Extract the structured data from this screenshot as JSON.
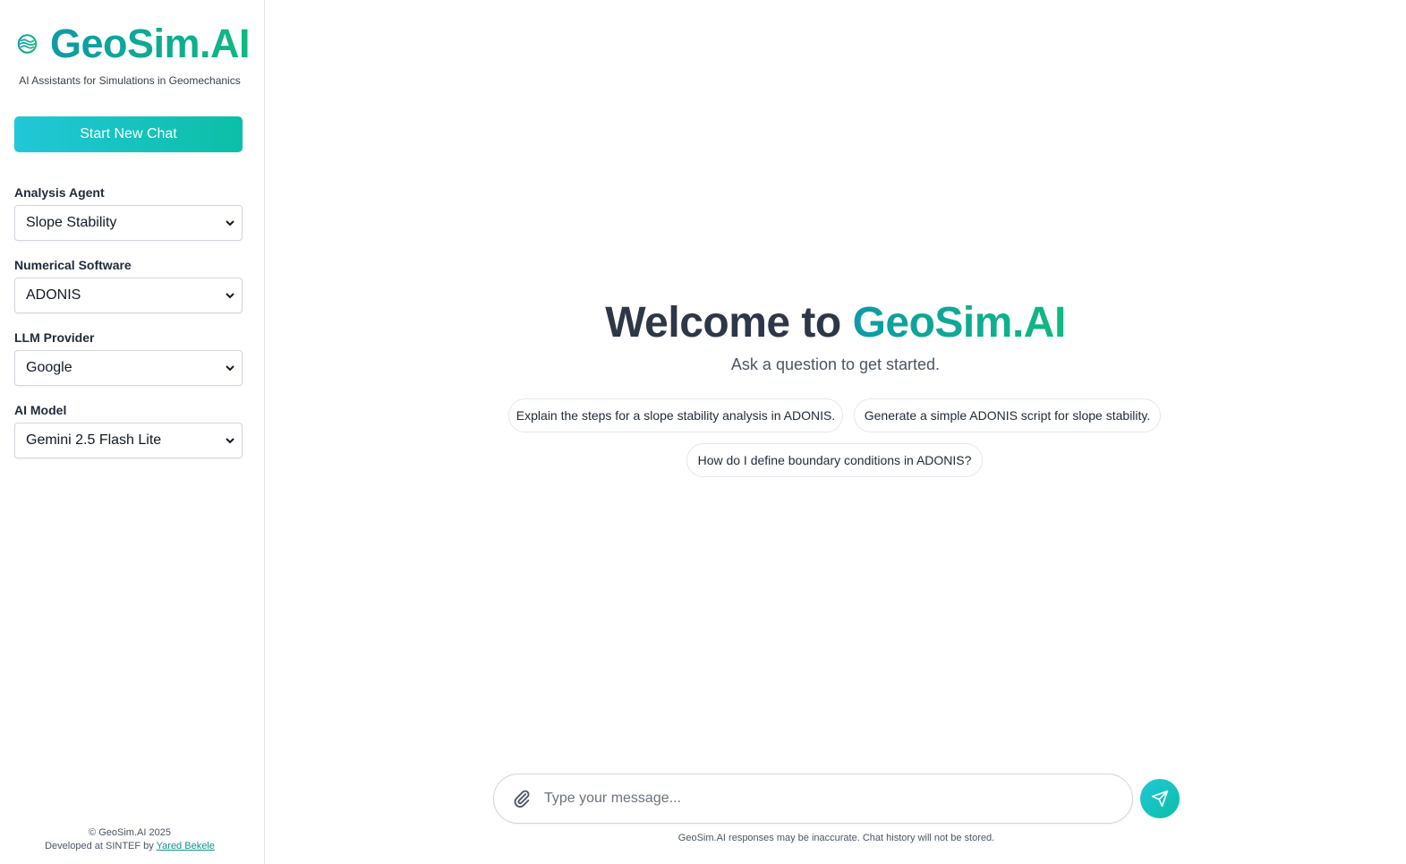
{
  "sidebar": {
    "brand_name": "GeoSim.AI",
    "brand_subtitle": "AI Assistants for Simulations in Geomechanics",
    "new_chat_label": "Start New Chat",
    "fields": [
      {
        "label": "Analysis Agent",
        "value": "Slope Stability"
      },
      {
        "label": "Numerical Software",
        "value": "ADONIS"
      },
      {
        "label": "LLM Provider",
        "value": "Google"
      },
      {
        "label": "AI Model",
        "value": "Gemini 2.5 Flash Lite"
      }
    ],
    "footer": {
      "copyright": "© GeoSim.AI 2025",
      "developed_prefix": "Developed at SINTEF by ",
      "author_link": "Yared Bekele"
    }
  },
  "main": {
    "welcome_prefix": "Welcome to ",
    "welcome_accent": "GeoSim.AI",
    "subtitle": "Ask a question to get started.",
    "suggestions": [
      "Explain the steps for a slope stability analysis in ADONIS.",
      "Generate a simple ADONIS script for slope stability.",
      "How do I define boundary conditions in ADONIS?"
    ],
    "composer": {
      "placeholder": "Type your message...",
      "value": ""
    },
    "disclaimer": "GeoSim.AI responses may be inaccurate. Chat history will not be stored."
  },
  "icons": {
    "logo": "waves-circle-icon",
    "attach": "paperclip-icon",
    "send": "send-icon",
    "dropdown": "chevron-down-icon"
  },
  "colors": {
    "accent_teal": "#0e9aa7",
    "accent_green": "#10b981",
    "button_gradient_start": "#22c7d8",
    "button_gradient_end": "#0bbfa6",
    "heading": "#2d3748"
  }
}
